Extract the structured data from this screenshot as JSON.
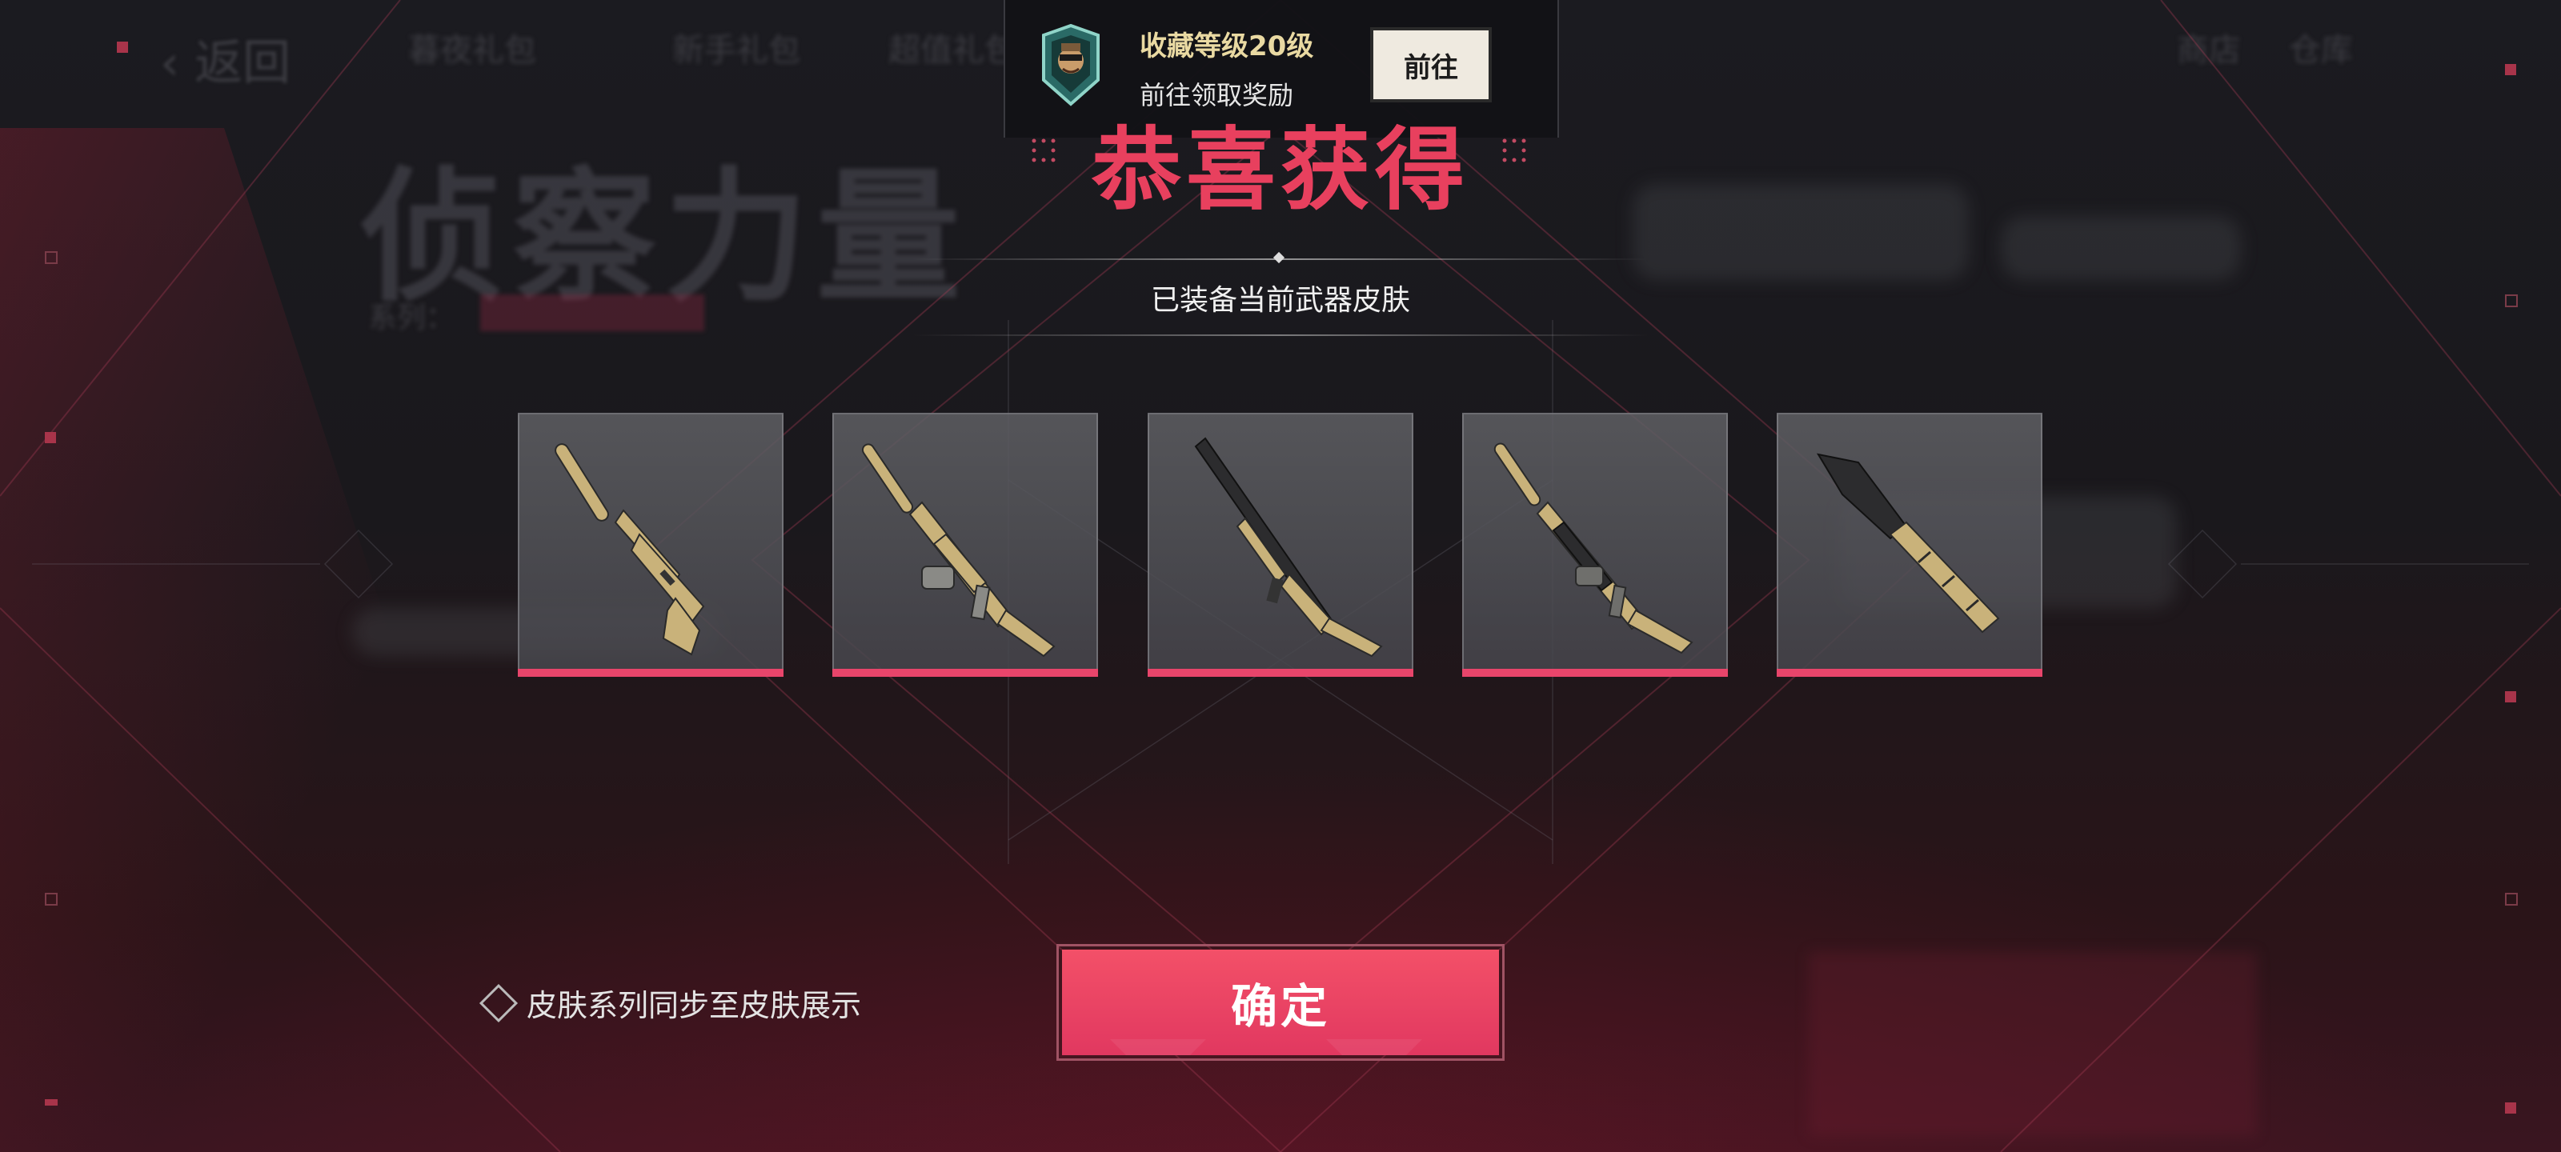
{
  "background": {
    "back_label": "返回",
    "tabs": [
      "暮夜礼包",
      "新手礼包",
      "超值礼包"
    ],
    "right_tabs": [
      "商店",
      "仓库"
    ],
    "series_title": "侦察力量",
    "series_label": "系列："
  },
  "notice": {
    "level_text": "收藏等级20级",
    "sub_text": "前往领取奖励",
    "goto_label": "前往",
    "badge_icon": "collection-badge-icon"
  },
  "reward": {
    "title": "恭喜获得",
    "subtitle": "已装备当前武器皮肤",
    "items": [
      {
        "name": "pistol-suppressed-skin",
        "rarity_color": "#e8456b"
      },
      {
        "name": "smg-suppressed-skin",
        "rarity_color": "#e8456b"
      },
      {
        "name": "marksman-rifle-skin",
        "rarity_color": "#e8456b"
      },
      {
        "name": "assault-rifle-suppressed-skin",
        "rarity_color": "#e8456b"
      },
      {
        "name": "tactical-knife-skin",
        "rarity_color": "#e8456b"
      }
    ]
  },
  "footer": {
    "sync_label": "皮肤系列同步至皮肤展示",
    "sync_checked": false,
    "confirm_label": "确定"
  },
  "colors": {
    "accent": "#e8405e",
    "gold_text": "#e9d9a2",
    "weapon_tan": "#c9b27a"
  }
}
